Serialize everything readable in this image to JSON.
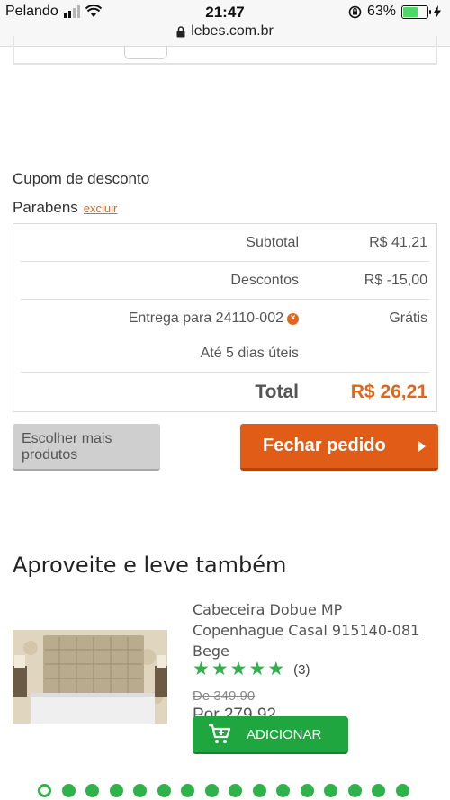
{
  "status_bar": {
    "carrier": "Pelando",
    "time": "21:47",
    "battery": "63%",
    "battery_level": 0.63,
    "url": "lebes.com.br"
  },
  "coupon": {
    "title": "Cupom de desconto",
    "status": "Parabens",
    "remove_label": "excluir"
  },
  "summary": {
    "subtotal_label": "Subtotal",
    "subtotal_value": "R$ 41,21",
    "discount_label": "Descontos",
    "discount_value": "R$ -15,00",
    "delivery_label": "Entrega para 24110-002",
    "delivery_value": "Grátis",
    "delivery_time": "Até 5 dias úteis",
    "total_label": "Total",
    "total_value": "R$ 26,21"
  },
  "actions": {
    "continue_label": "Escolher mais produtos",
    "checkout_label": "Fechar pedido"
  },
  "upsell": {
    "title": "Aproveite e leve também",
    "product": {
      "name": "Cabeceira Dobue MP Copenhague Casal 915140-081 Bege",
      "rating": 5,
      "reviews": "(3)",
      "old_price": "De 349,90",
      "new_price": "Por 279,92",
      "add_label": "ADICIONAR"
    }
  },
  "carousel": {
    "page_count": 16,
    "active_index": 0
  },
  "colors": {
    "accent_orange": "#e05c17",
    "accent_green": "#1fa63f"
  }
}
